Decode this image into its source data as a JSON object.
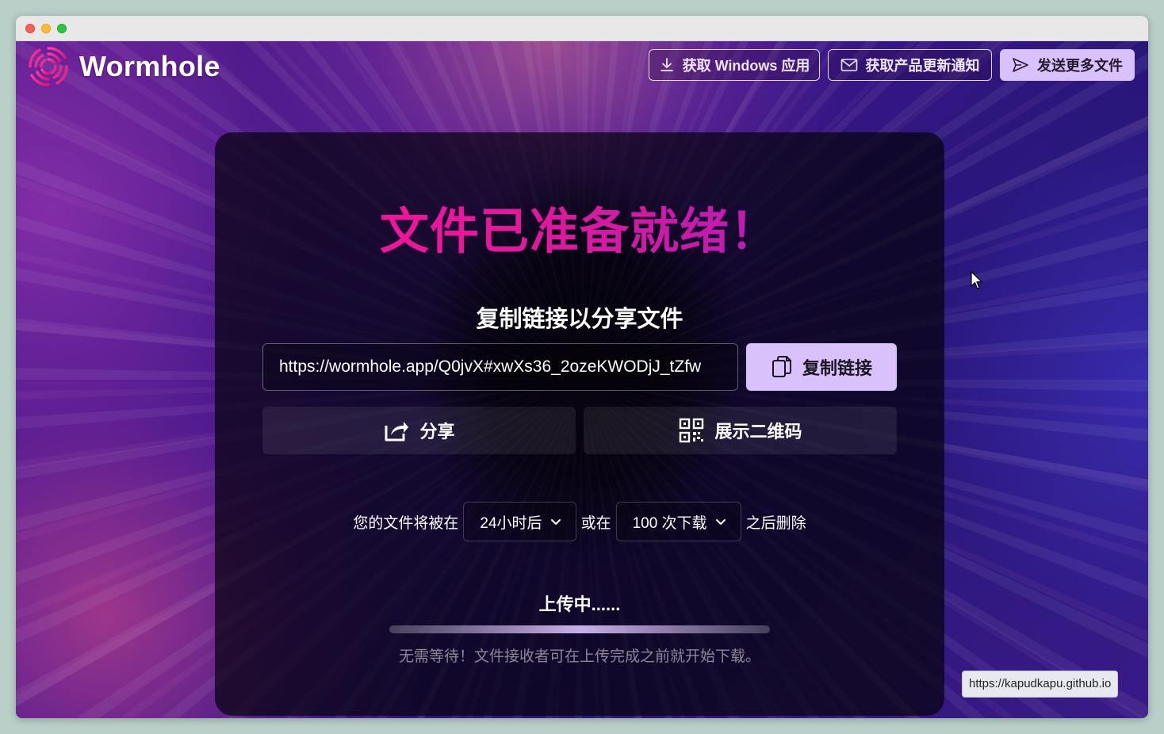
{
  "app": {
    "name": "Wormhole"
  },
  "header": {
    "windows_app_label": "获取 Windows 应用",
    "updates_label": "获取产品更新通知",
    "send_more_label": "发送更多文件"
  },
  "card": {
    "title": "文件已准备就绪！",
    "subtitle": "复制链接以分享文件",
    "share_url": "https://wormhole.app/Q0jvX#xwXs36_2ozeKWODjJ_tZfw",
    "copy_label": "复制链接",
    "share_label": "分享",
    "qr_label": "展示二维码"
  },
  "expiry": {
    "prefix": "您的文件将被在",
    "time_value": "24小时后",
    "middle": "或在",
    "downloads_value": "100 次下载",
    "suffix": "之后删除"
  },
  "upload": {
    "status": "上传中......",
    "hint": "无需等待！文件接收者可在上传完成之前就开始下载。"
  },
  "status_bar": {
    "link": "https://kapudkapu.github.io"
  },
  "colors": {
    "accent": "#d9c2fb",
    "title_start": "#ff1493",
    "title_end": "#9b1fc4"
  }
}
